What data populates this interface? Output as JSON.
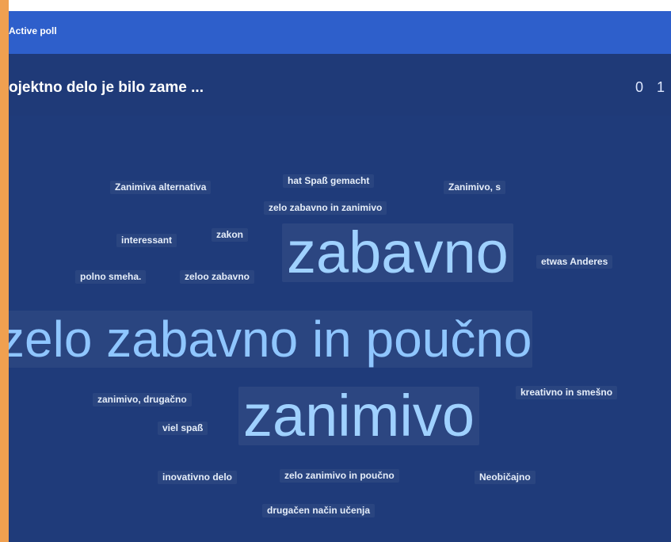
{
  "header": {
    "label": "Active poll"
  },
  "poll": {
    "title": "ojektno delo je bilo zame ...",
    "counts": "0 1"
  },
  "cloud": [
    {
      "key": "w1",
      "text": "Zanimiva alternativa"
    },
    {
      "key": "w2",
      "text": "hat Spaß gemacht"
    },
    {
      "key": "w3",
      "text": "Zanimivo, s"
    },
    {
      "key": "w4",
      "text": "zelo zabavno in zanimivo"
    },
    {
      "key": "w5",
      "text": "interessant"
    },
    {
      "key": "w6",
      "text": "zakon"
    },
    {
      "key": "w7",
      "text": "polno smeha."
    },
    {
      "key": "w8",
      "text": "zeloo zabavno"
    },
    {
      "key": "w9",
      "text": "zabavno"
    },
    {
      "key": "w10",
      "text": "etwas Anderes"
    },
    {
      "key": "w11",
      "text": "zelo zabavno in poučno"
    },
    {
      "key": "w12",
      "text": "zanimivo, drugačno"
    },
    {
      "key": "w13",
      "text": "kreativno in smešno"
    },
    {
      "key": "w14",
      "text": "viel spaß"
    },
    {
      "key": "w15",
      "text": "zanimivo"
    },
    {
      "key": "w16",
      "text": "inovativno delo"
    },
    {
      "key": "w17",
      "text": "zelo zanimivo in poučno"
    },
    {
      "key": "w18",
      "text": "Neobičajno"
    },
    {
      "key": "w19",
      "text": "drugačen način učenja"
    }
  ]
}
